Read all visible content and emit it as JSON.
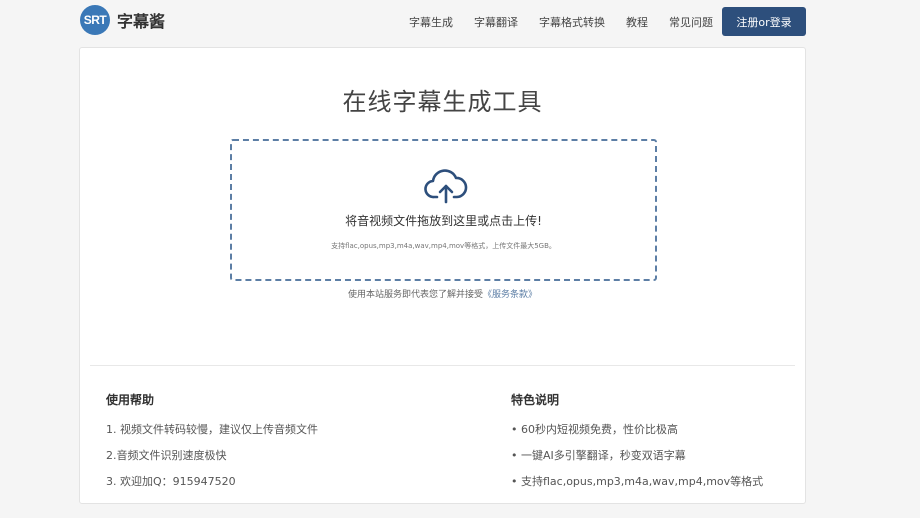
{
  "brand": {
    "badge": "SRT",
    "name": "字幕酱"
  },
  "nav": {
    "links": [
      "字幕生成",
      "字幕翻译",
      "字幕格式转换",
      "教程",
      "常见问题"
    ],
    "login_label": "注册or登录"
  },
  "main": {
    "title": "在线字幕生成工具",
    "dropzone": {
      "icon": "cloud-upload-icon",
      "text": "将音视频文件拖放到这里或点击上传!",
      "hint": "支持flac,opus,mp3,m4a,wav,mp4,mov等格式，上传文件最大5GB。"
    },
    "terms_prefix": "使用本站服务即代表您了解并接受",
    "terms_link": "《服务条款》"
  },
  "help": {
    "title": "使用帮助",
    "items": [
      "1. 视频文件转码较慢，建议仅上传音频文件",
      "2.音频文件识别速度极快",
      "3. 欢迎加Q：915947520"
    ]
  },
  "features": {
    "title": "特色说明",
    "items": [
      "• 60秒内短视频免费，性价比极高",
      "• 一键AI多引擎翻译，秒变双语字幕",
      "• 支持flac,opus,mp3,m4a,wav,mp4,mov等格式"
    ]
  },
  "colors": {
    "accent": "#2d4f7c",
    "logo": "#3a78b7",
    "dropzone_border": "#5c7ea5",
    "background": "#f5f5f5"
  }
}
